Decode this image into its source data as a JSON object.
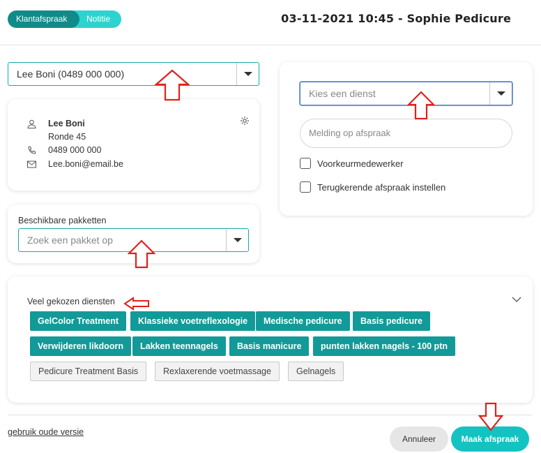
{
  "header": {
    "tabs": [
      {
        "label": "Klantafspraak",
        "active": true
      },
      {
        "label": "Notitie",
        "active": false
      }
    ],
    "title": "03-11-2021 10:45 - Sophie Pedicure"
  },
  "client": {
    "select_value": "Lee Boni (0489 000 000)",
    "name": "Lee Boni",
    "address": "Ronde 45",
    "phone": "0489 000 000",
    "email": "Lee.boni@email.be"
  },
  "packages": {
    "label": "Beschikbare pakketten",
    "placeholder": "Zoek een pakket op"
  },
  "service": {
    "placeholder": "Kies een dienst",
    "note_placeholder": "Melding op afspraak",
    "preferred_employee_label": "Voorkeurmedewerker",
    "recurring_label": "Terugkerende afspraak instellen"
  },
  "popular": {
    "label": "Veel gekozen diensten",
    "featured": [
      "GelColor Treatment",
      "Klassieke voetreflexologie",
      "Medische pedicure",
      "Basis pedicure",
      "Verwijderen likdoorn",
      "Lakken teennagels",
      "Basis manicure",
      "punten lakken nagels - 100 ptn"
    ],
    "other": [
      "Pedicure Treatment Basis",
      "Rexlaxerende voetmassage",
      "Gelnagels"
    ]
  },
  "footer": {
    "old_version_link": "gebruik oude versie",
    "cancel_label": "Annuleer",
    "submit_label": "Maak afspraak"
  },
  "colors": {
    "accent": "#13c3c2",
    "accent_dark": "#118b8a",
    "chip_teal": "#129a98",
    "annotation_arrow": "#e0201c"
  }
}
